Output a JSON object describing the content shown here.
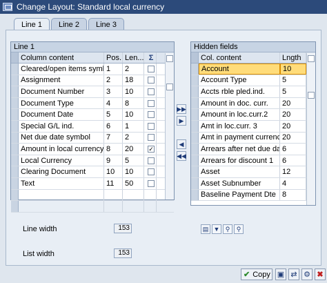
{
  "window": {
    "title": "Change Layout: Standard local currency"
  },
  "tabs": [
    {
      "label": "Line 1"
    },
    {
      "label": "Line 2"
    },
    {
      "label": "Line 3"
    }
  ],
  "left_grid": {
    "title": "Line 1",
    "headers": {
      "content": "Column content",
      "pos": "Pos.",
      "len": "Len...",
      "sum_icon": "sum-icon"
    },
    "rows": [
      {
        "content": "Cleared/open items symbol",
        "pos": "1",
        "len": "2",
        "sum": false
      },
      {
        "content": "Assignment",
        "pos": "2",
        "len": "18",
        "sum": false
      },
      {
        "content": "Document Number",
        "pos": "3",
        "len": "10",
        "sum": false
      },
      {
        "content": "Document Type",
        "pos": "4",
        "len": "8",
        "sum": false
      },
      {
        "content": "Document Date",
        "pos": "5",
        "len": "10",
        "sum": false
      },
      {
        "content": "Special G/L ind.",
        "pos": "6",
        "len": "1",
        "sum": false
      },
      {
        "content": "Net due date symbol",
        "pos": "7",
        "len": "2",
        "sum": false
      },
      {
        "content": "Amount in local currency",
        "pos": "8",
        "len": "20",
        "sum": true
      },
      {
        "content": "Local Currency",
        "pos": "9",
        "len": "5",
        "sum": false
      },
      {
        "content": "Clearing Document",
        "pos": "10",
        "len": "10",
        "sum": false
      },
      {
        "content": "Text",
        "pos": "11",
        "len": "50",
        "sum": false
      },
      {
        "content": "",
        "pos": "",
        "len": "",
        "sum": false
      },
      {
        "content": "",
        "pos": "",
        "len": "",
        "sum": false
      }
    ]
  },
  "right_grid": {
    "title": "Hidden fields",
    "headers": {
      "content": "Col. content",
      "len": "Lngth"
    },
    "rows": [
      {
        "content": "Account",
        "len": "10"
      },
      {
        "content": "Account Type",
        "len": "5"
      },
      {
        "content": "Accts rble pled.ind.",
        "len": "5"
      },
      {
        "content": "Amount in doc. curr.",
        "len": "20"
      },
      {
        "content": "Amount in loc.curr.2",
        "len": "20"
      },
      {
        "content": "Amt in loc.curr. 3",
        "len": "20"
      },
      {
        "content": "Amt in payment currency",
        "len": "20"
      },
      {
        "content": "Arrears after net due dat...",
        "len": "6"
      },
      {
        "content": "Arrears for discount 1",
        "len": "6"
      },
      {
        "content": "Asset",
        "len": "12"
      },
      {
        "content": "Asset Subnumber",
        "len": "4"
      },
      {
        "content": "Baseline Payment Dte",
        "len": "8"
      }
    ]
  },
  "footer_fields": {
    "line_width_label": "Line width",
    "line_width_value": "153",
    "list_width_label": "List width",
    "list_width_value": "153"
  },
  "buttons": {
    "copy_label": "Copy"
  },
  "colors": {
    "titlebar": "#2c4a7a",
    "highlight": "#ffdc7a",
    "panel": "#e8eef5"
  }
}
